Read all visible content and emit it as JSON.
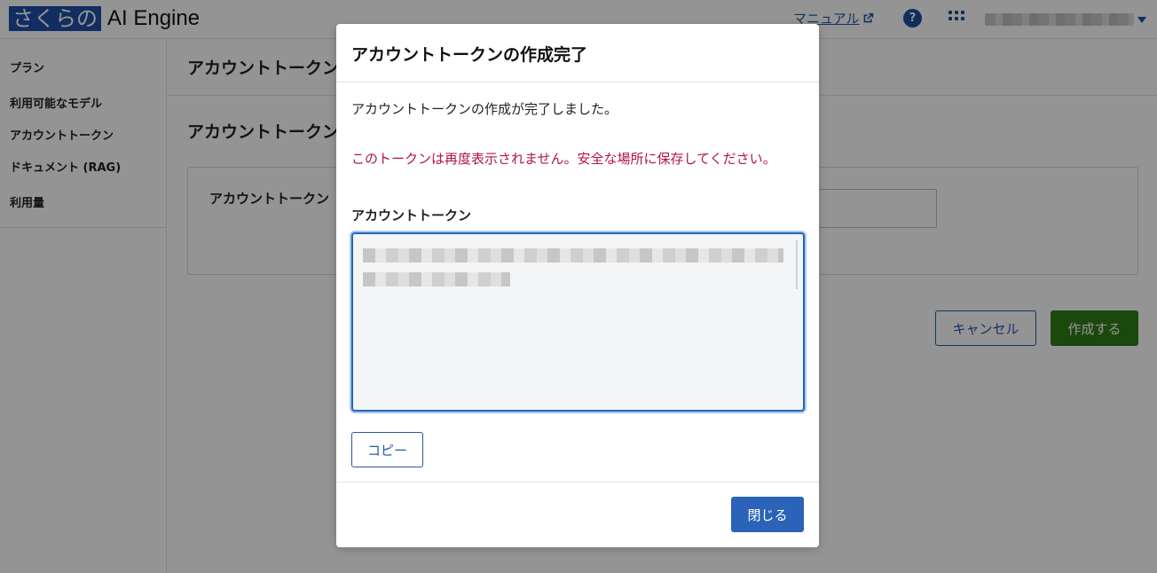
{
  "header": {
    "logo_sakura": "さくらの",
    "logo_ai": "AI Engine",
    "manual_label": "マニュアル",
    "help_label": "?"
  },
  "sidebar": {
    "items": [
      {
        "label": "プラン"
      },
      {
        "label": "利用可能なモデル"
      },
      {
        "label": "アカウントトークン"
      },
      {
        "label": "ドキュメント (RAG)"
      },
      {
        "label": "利用量"
      }
    ]
  },
  "main": {
    "title": "アカウントトークン",
    "subtitle": "アカウントトークン",
    "form_label": "アカウントトークン",
    "cancel_label": "キャンセル",
    "create_label": "作成する"
  },
  "modal": {
    "title": "アカウントトークンの作成完了",
    "message": "アカウントトークンの作成が完了しました。",
    "warning": "このトークンは再度表示されません。安全な場所に保存してください。",
    "token_label": "アカウントトークン",
    "copy_label": "コピー",
    "close_label": "閉じる"
  },
  "colors": {
    "brand_blue": "#1e4fa8",
    "create_green": "#2f7d17",
    "warning_red": "#b3124e"
  },
  "icons": {
    "external_link": "external-link-icon",
    "help": "help-icon",
    "apps": "apps-grid-icon",
    "user_caret": "chevron-down-icon"
  }
}
